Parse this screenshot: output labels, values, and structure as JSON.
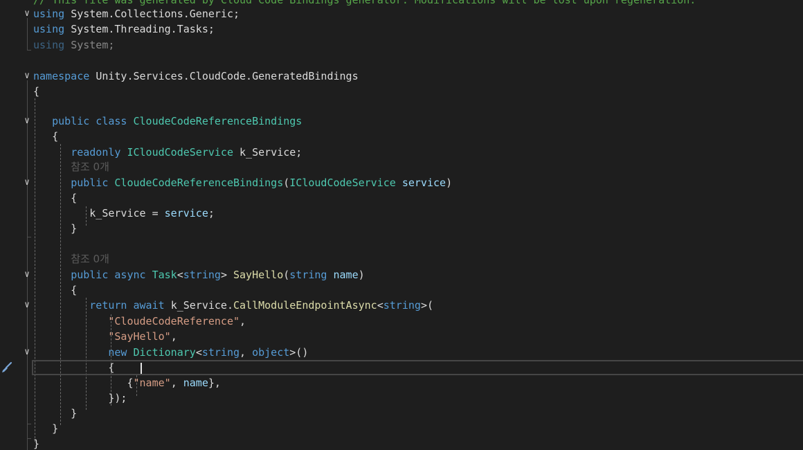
{
  "editor": {
    "comment": "// This file was generated by Cloud Code Bindings generator. Modifications will be lost upon regeneration.",
    "using1_kw": "using",
    "using1_ns": "System.Collections.Generic",
    "using2_kw": "using",
    "using2_ns": "System.Threading.Tasks",
    "using3_kw": "using",
    "using3_ns": "System",
    "namespace_kw": "namespace",
    "namespace_name": "Unity.Services.CloudCode.GeneratedBindings",
    "class_mods": "public class",
    "class_name": "CloudeCodeReferenceBindings",
    "readonly_kw": "readonly",
    "service_type": "ICloudCodeService",
    "field_name": "k_Service;",
    "codelens_ctor": "참조 0개",
    "ctor_public": "public",
    "ctor_name": "CloudeCodeReferenceBindings",
    "ctor_param_type": "ICloudCodeService",
    "ctor_param_name": "service",
    "assign_lhs": "k_Service",
    "assign_rhs": "service",
    "codelens_method": "참조 0개",
    "method_mods": "public async",
    "task_type": "Task",
    "string_kw": "string",
    "method_name": "SayHello",
    "param_name": "name",
    "return_kw": "return",
    "await_kw": "await",
    "call_obj": "k_Service",
    "call_method": "CallModuleEndpointAsync",
    "arg_module": "\"CloudeCodeReference\"",
    "arg_endpoint": "\"SayHello\"",
    "new_kw": "new",
    "dict_type": "Dictionary",
    "object_kw": "object",
    "name_key": "\"name\""
  },
  "icons": {
    "gutter": "paint-brush-icon",
    "fold": "chevron-down-icon"
  },
  "colors": {
    "background": "#1e1e1e",
    "keyword": "#569cd6",
    "type": "#4ec9b0",
    "method": "#dcdcaa",
    "string": "#d69d85",
    "parameter": "#9cdcfe",
    "comment": "#57a64a"
  }
}
